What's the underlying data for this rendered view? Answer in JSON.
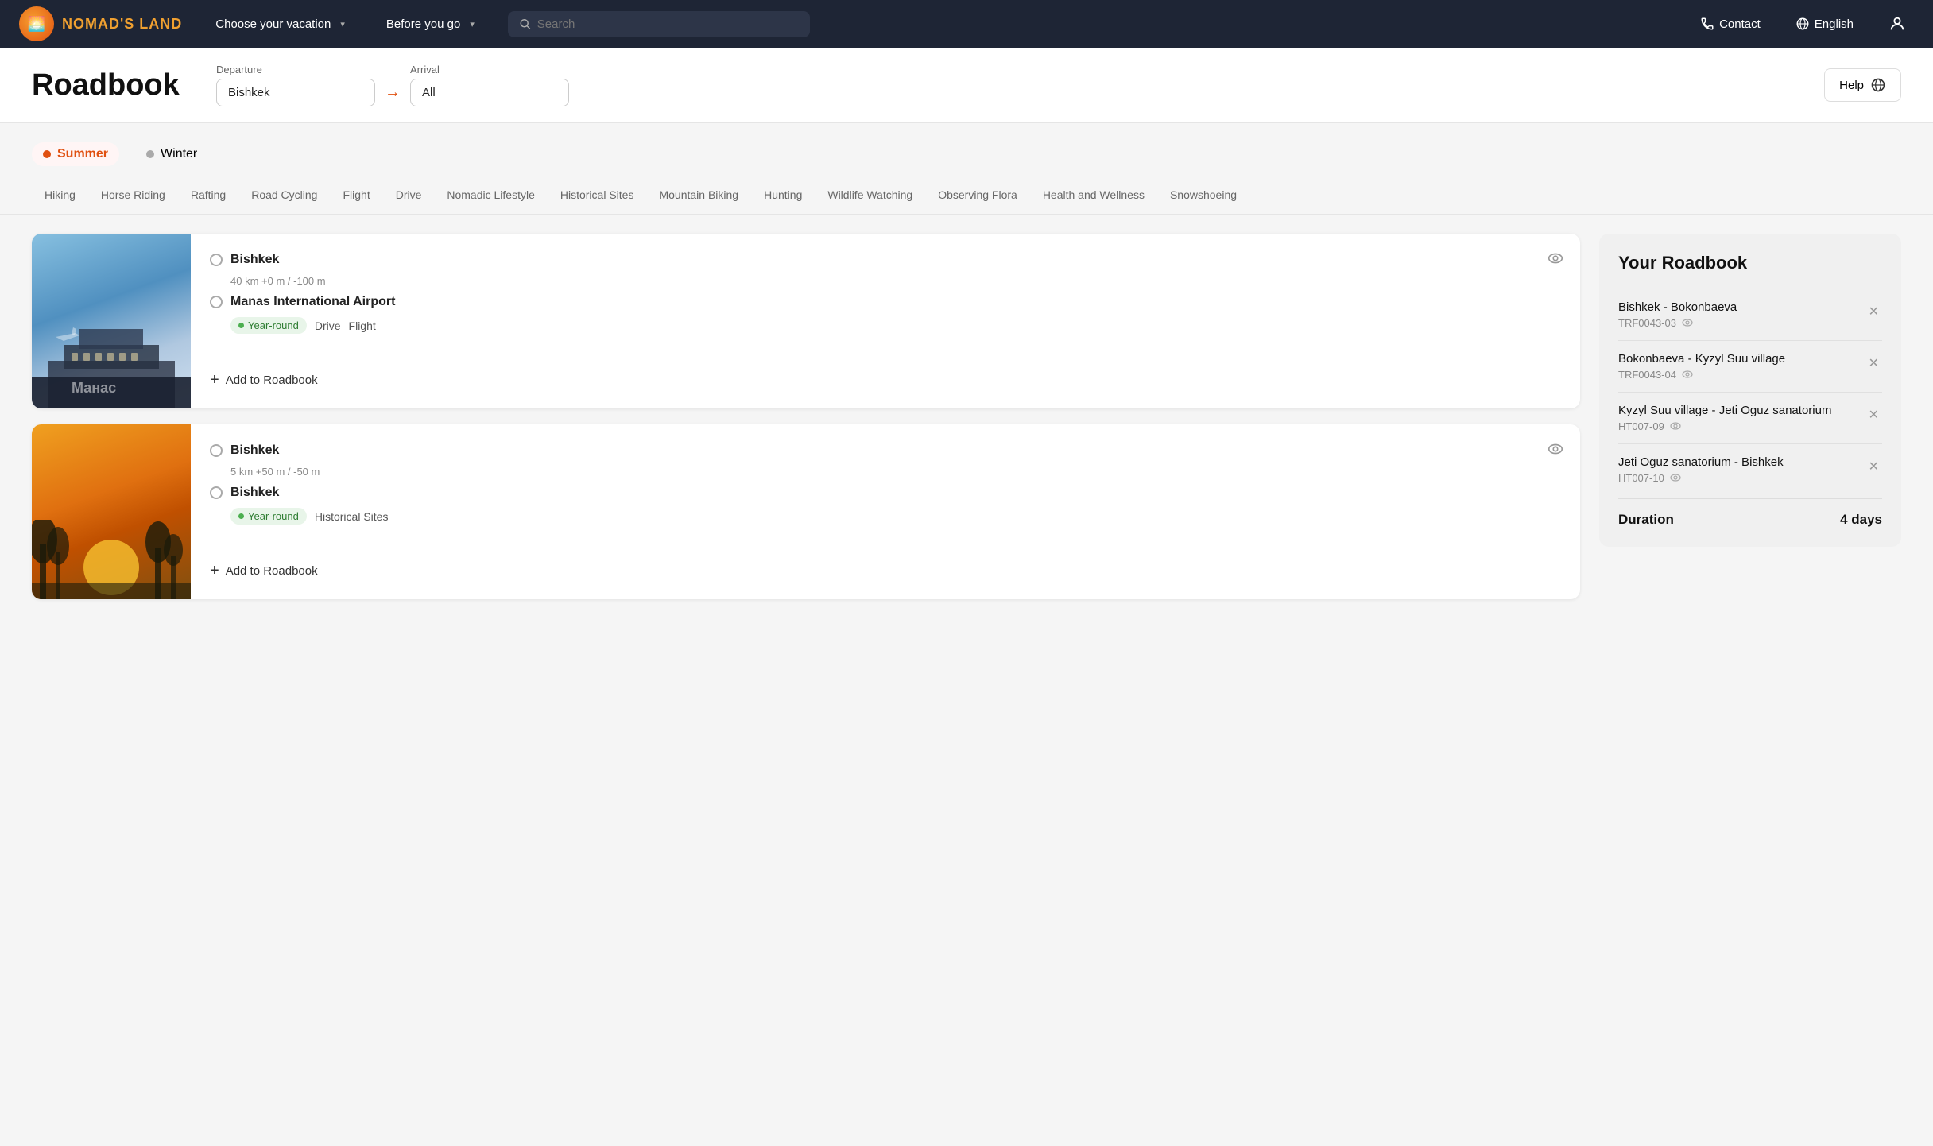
{
  "navbar": {
    "logo_emoji": "🌅",
    "logo_text": "NOMAD'S LAND",
    "menu1_label": "Choose your vacation",
    "menu2_label": "Before you go",
    "search_placeholder": "Search",
    "contact_label": "Contact",
    "language_label": "English"
  },
  "header": {
    "title": "Roadbook",
    "departure_label": "Departure",
    "departure_value": "Bishkek",
    "arrival_label": "Arrival",
    "arrival_value": "All",
    "help_label": "Help"
  },
  "seasons": {
    "summer_label": "Summer",
    "winter_label": "Winter"
  },
  "categories": [
    "Hiking",
    "Horse Riding",
    "Rafting",
    "Road Cycling",
    "Flight",
    "Drive",
    "Nomadic Lifestyle",
    "Historical Sites",
    "Mountain Biking",
    "Hunting",
    "Wildlife Watching",
    "Observing Flora",
    "Health and Wellness",
    "Snowshoeing"
  ],
  "trips": [
    {
      "from": "Bishkek",
      "stats": "40 km   +0 m / -100 m",
      "to": "Manas International Airport",
      "season": "Year-round",
      "tags": [
        "Drive",
        "Flight"
      ],
      "add_label": "Add to Roadbook",
      "img_type": "airport"
    },
    {
      "from": "Bishkek",
      "stats": "5 km   +50 m / -50 m",
      "to": "Bishkek",
      "season": "Year-round",
      "tags": [
        "Historical Sites"
      ],
      "add_label": "Add to Roadbook",
      "img_type": "sunset"
    }
  ],
  "roadbook": {
    "title": "Your Roadbook",
    "items": [
      {
        "name": "Bishkek - Bokonbaeva",
        "code": "TRF0043-03"
      },
      {
        "name": "Bokonbaeva - Kyzyl Suu village",
        "code": "TRF0043-04"
      },
      {
        "name": "Kyzyl Suu village - Jeti Oguz sanatorium",
        "code": "HT007-09"
      },
      {
        "name": "Jeti Oguz sanatorium - Bishkek",
        "code": "HT007-10"
      }
    ],
    "duration_label": "Duration",
    "duration_value": "4 days"
  }
}
